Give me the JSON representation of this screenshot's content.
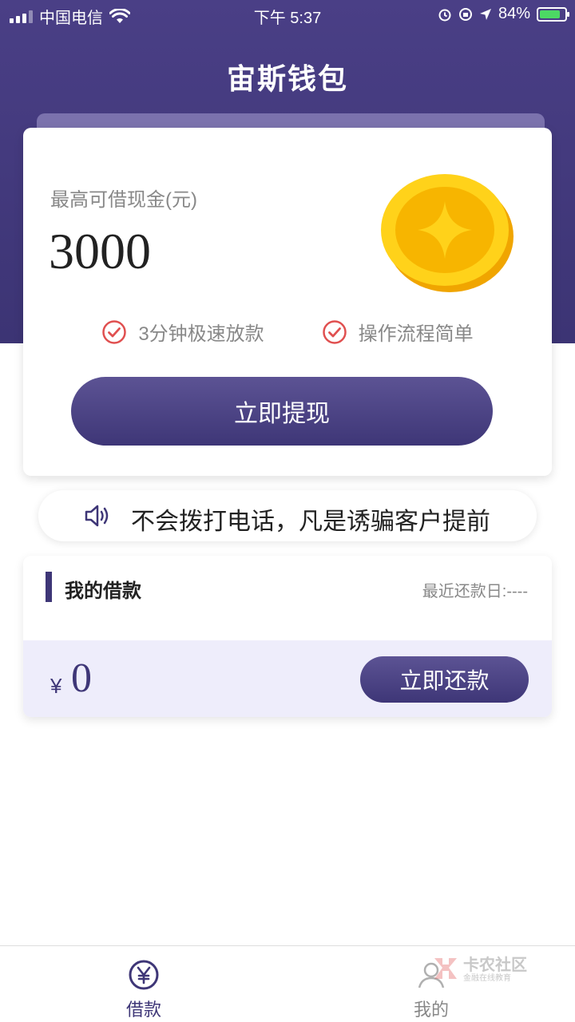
{
  "status_bar": {
    "carrier": "中国电信",
    "time": "下午 5:37",
    "battery": "84%",
    "battery_level": 0.84
  },
  "header": {
    "title": "宙斯钱包"
  },
  "main_card": {
    "limit_label": "最高可借现金(元)",
    "limit_amount": "3000",
    "features": [
      "3分钟极速放款",
      "操作流程简单"
    ],
    "withdraw_label": "立即提现"
  },
  "notice": {
    "text": "不会拨打电话，凡是诱骗客户提前"
  },
  "loan_card": {
    "title": "我的借款",
    "repay_date_label": "最近还款日:----",
    "currency_symbol": "¥",
    "amount": "0",
    "repay_label": "立即还款"
  },
  "tab_bar": {
    "tabs": [
      {
        "label": "借款",
        "icon": "yen-circle-icon",
        "active": true
      },
      {
        "label": "我的",
        "icon": "user-icon",
        "active": false
      }
    ]
  },
  "watermark": {
    "main": "卡农社区",
    "sub": "金融在线教育"
  },
  "colors": {
    "brand": "#3e3677",
    "header": "#4a3f86",
    "check": "#e05050",
    "coin": "#f7b500"
  }
}
